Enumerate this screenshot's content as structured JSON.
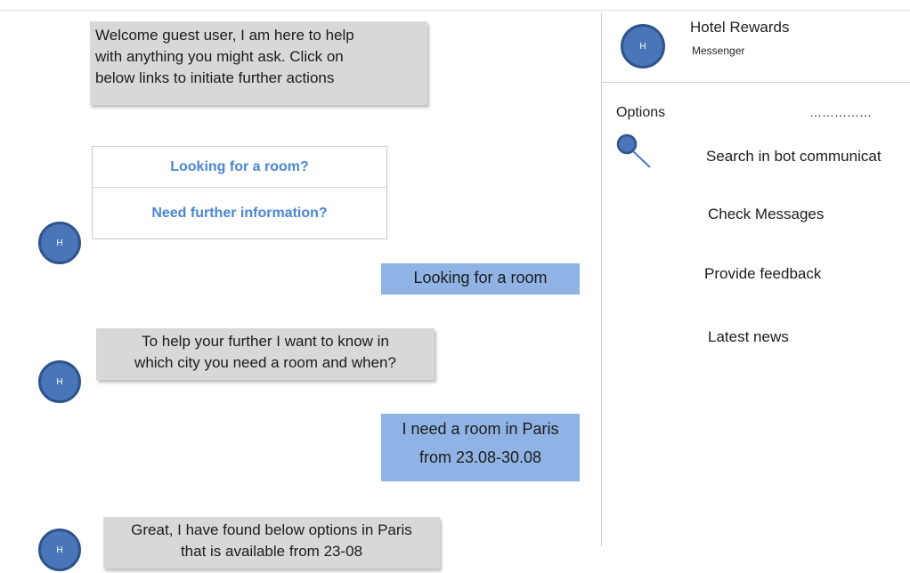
{
  "header": {
    "title": "Hotel Rewards",
    "subtitle": "Messenger",
    "avatar_letter": "H"
  },
  "options": {
    "label": "Options",
    "dots": "……………",
    "items": [
      {
        "label": "Search in bot communicat",
        "icon": "search-icon"
      },
      {
        "label": "Check Messages"
      },
      {
        "label": "Provide feedback"
      },
      {
        "label": "Latest news"
      }
    ]
  },
  "chat": {
    "bot_avatar_letter": "H",
    "welcome": {
      "line1": "Welcome guest user, I am here to help",
      "line2": "with anything you might ask. Click on",
      "line3": "below links to initiate further actions"
    },
    "quick_links": [
      "Looking for a room?",
      "Need further information?"
    ],
    "user_reply_1": "Looking for a room",
    "bot_question": {
      "line1": "To help your further I want to know in",
      "line2": "which city you need a room and when?"
    },
    "user_reply_2": {
      "line1": "I need a room in Paris",
      "line2": "from 23.08-30.08"
    },
    "bot_result": {
      "line1": "Great, I have found below options in Paris",
      "line2": "that is available from 23-08"
    }
  },
  "colors": {
    "bot_bubble": "#d8d8d8",
    "user_bubble": "#8fb3e4",
    "avatar": "#4a76b9",
    "link": "#4a86d4"
  }
}
